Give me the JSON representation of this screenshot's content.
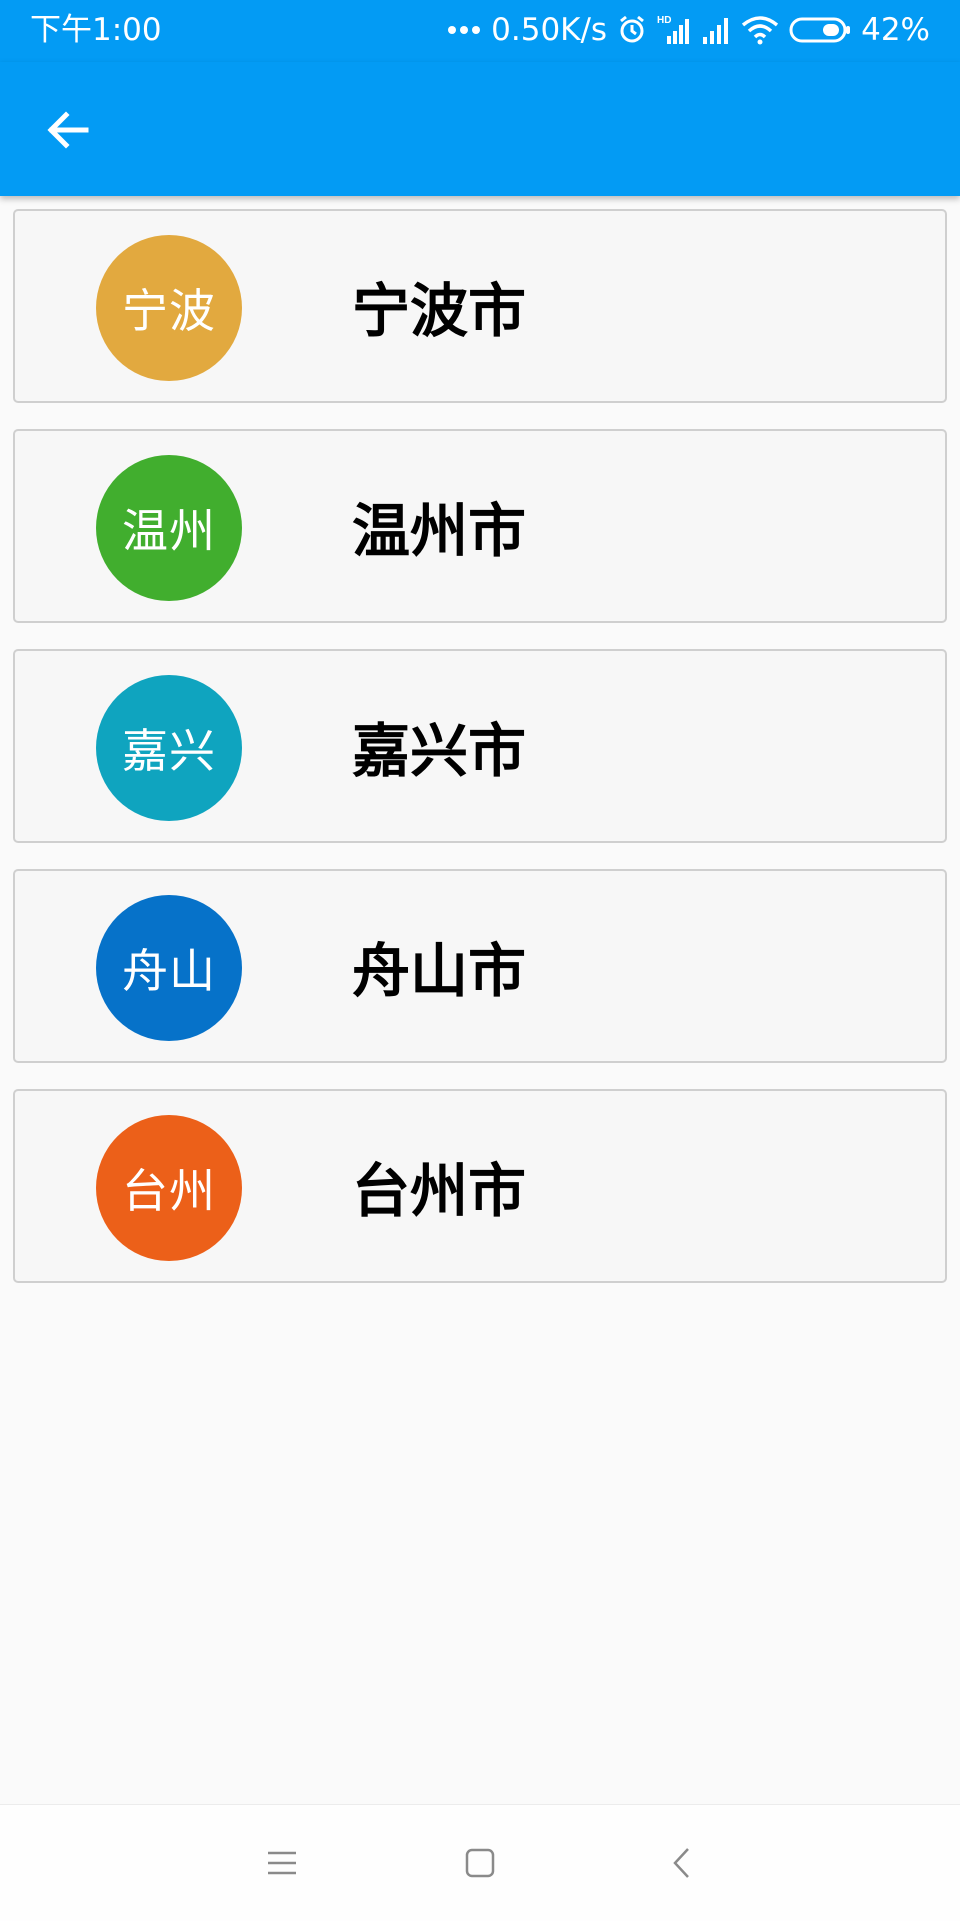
{
  "status_bar": {
    "time": "下午1:00",
    "network_speed": "0.50K/s",
    "network_type": "HD",
    "battery": "42%",
    "icons": [
      "more-dots-icon",
      "alarm-icon",
      "signal-hd-icon",
      "signal-icon",
      "wifi-icon",
      "battery-icon"
    ]
  },
  "app_bar": {
    "back_icon": "arrow-left-icon"
  },
  "cities": [
    {
      "badge": "宁波",
      "name": "宁波市",
      "color": "#E2A93F"
    },
    {
      "badge": "温州",
      "name": "温州市",
      "color": "#41AE2E"
    },
    {
      "badge": "嘉兴",
      "name": "嘉兴市",
      "color": "#0FA4BF"
    },
    {
      "badge": "舟山",
      "name": "舟山市",
      "color": "#0672C9"
    },
    {
      "badge": "台州",
      "name": "台州市",
      "color": "#EC6019"
    }
  ],
  "nav_bar": {
    "icons": [
      "menu-icon",
      "home-square-icon",
      "back-chevron-icon"
    ]
  },
  "colors": {
    "primary": "#039BF4",
    "background": "#FAFAFA"
  }
}
